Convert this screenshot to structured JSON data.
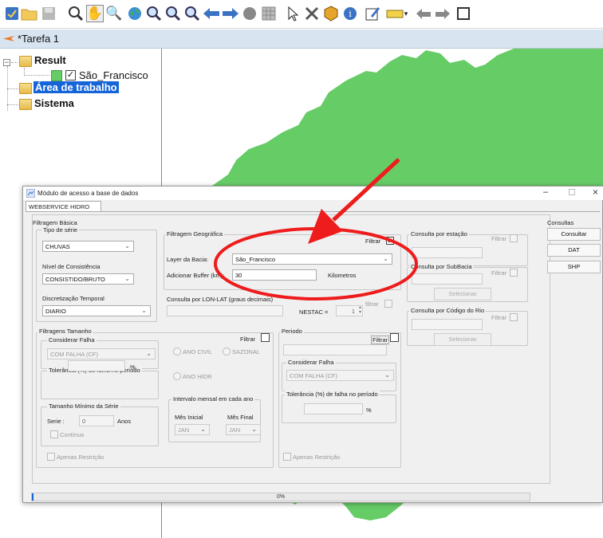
{
  "toolbar": {
    "icons": [
      "app-icon",
      "open-folder-icon",
      "save-icon",
      "zoom-icon",
      "pan-hand-icon",
      "pan-zoom-icon",
      "globe-icon",
      "zoom-in-area-icon",
      "zoom-out-area-icon",
      "zoom-previous-icon",
      "arrow-left-icon",
      "arrow-right-icon",
      "layer-icon",
      "grid-icon",
      "pointer-icon",
      "measure-icon",
      "cube-icon",
      "info-icon",
      "edit-icon",
      "ruler-icon",
      "dropdown-icon",
      "undo-icon",
      "redo-icon",
      "window-icon"
    ]
  },
  "task_tab": {
    "label": "*Tarefa 1"
  },
  "tree": {
    "result": "Result",
    "layer": "São_Francisco",
    "workspace": "Área de trabalho",
    "system": "Sistema"
  },
  "map": {
    "fill_color": "#66cc66",
    "arrow_color": "#ee1c1c"
  },
  "dialog": {
    "title": "Módulo de acesso a base de dados",
    "tab": "WEBSERVICE HIDRO",
    "basic_filter": {
      "group": "Filtragem Básica",
      "series_type_label": "Tipo de série",
      "series_type_value": "CHUVAS",
      "consistency_label": "Nível de Consistência",
      "consistency_value": "CONSISTIDO/BRUTO",
      "time_label": "Discretização Temporal",
      "time_value": "DIARIO"
    },
    "geo_filter": {
      "group": "Filtragem Geográfica",
      "filter_label": "Filtrar",
      "basin_label": "Layer da Bacia:",
      "basin_value": "São_Francisco",
      "buffer_label": "Adicionar Buffer (km):",
      "buffer_value": "30",
      "buffer_unit": "Kilometros"
    },
    "lonlat": {
      "group": "Consulta por LON-LAT (graus decimais)",
      "filter_label": "filtrar",
      "nestac_label": "NESTAC =",
      "nestac_value": "1"
    },
    "station": {
      "group": "Consulta por estação",
      "filter_label": "Filtrar"
    },
    "subbasin": {
      "group": "Consulta por SubBacia",
      "filter_label": "Filtrar",
      "button": "Selecionar"
    },
    "river": {
      "group": "Consulta por Código do Rio",
      "filter_label": "Filtrar",
      "button": "Selecionar"
    },
    "queries": {
      "group": "Consultas",
      "consult": "Consultar",
      "dat": "DAT",
      "shp": "SHP"
    },
    "size_filter": {
      "group": "Filtragens Tamanho",
      "filter_label": "Filtrar",
      "consider_failure": "Considerar Falha",
      "failure_value": "COM FALHA (CF)",
      "tolerance_label": "Tolerância (%) de falha no período",
      "percent": "%",
      "min_size_label": "Tamanho Mínimo da Série",
      "serie_label": "Serie :",
      "serie_value": "0",
      "years_label": "Anos",
      "continuous_label": "Contínuo",
      "civil_year": "ANO CIVIL",
      "seasonal": "SAZONAL",
      "hydro_year": "ANO HIDR",
      "monthly_interval": "Intervalo mensal em cada ano",
      "start_month_label": "Mês Inicial",
      "end_month_label": "Mês Final",
      "start_month": "JAN",
      "end_month": "JAN",
      "restriction_label": "Apenas Restrição"
    },
    "period": {
      "group": "Periodo",
      "filter_label": "Filtrar",
      "consider_failure": "Considerar Falha",
      "failure_value": "COM FALHA (CF)",
      "tolerance_label": "Tolerância (%) de falha no período",
      "percent": "%",
      "restriction_label": "Apenas Restrição"
    },
    "progress": {
      "value": 0,
      "text": "0%"
    }
  }
}
